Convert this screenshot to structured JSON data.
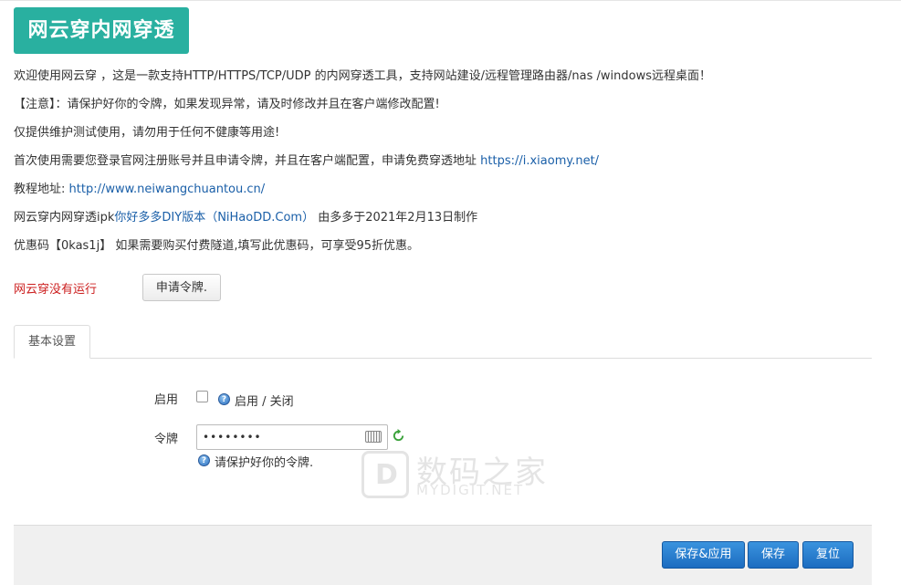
{
  "header": {
    "title": "网云穿内网穿透"
  },
  "intro": {
    "line1": "欢迎使用网云穿 ，这是一款支持HTTP/HTTPS/TCP/UDP 的内网穿透工具，支持网站建设/远程管理路由器/nas /windows远程桌面！",
    "line2": "【注意】：请保护好你的令牌，如果发现异常，请及时修改并且在客户端修改配置!",
    "line3": "仅提供维护测试使用，请勿用于任何不健康等用途!",
    "line4_prefix": "首次使用需要您登录官网注册账号并且申请令牌，并且在客户端配置，申请免费穿透地址 ",
    "line4_link": "https://i.xiaomy.net/",
    "line5_prefix": "教程地址: ",
    "line5_link": "http://www.neiwangchuantou.cn/",
    "line6_prefix": "网云穿内网穿透ipk",
    "line6_link": "你好多多DIY版本（NiHaoDD.Com）",
    "line6_suffix": "由多多于2021年2月13日制作",
    "line7": "优惠码【0kas1j】 如果需要购买付费隧道,填写此优惠码，可享受95折优惠。"
  },
  "status": {
    "text": "网云穿没有运行",
    "apply_button": "申请令牌."
  },
  "tabs": [
    {
      "label": "基本设置"
    }
  ],
  "form": {
    "enable": {
      "label": "启用",
      "checked": false,
      "help": "启用 / 关闭"
    },
    "token": {
      "label": "令牌",
      "value": "••••••••",
      "help": "请保护好你的令牌."
    }
  },
  "footer": {
    "save_apply": "保存&应用",
    "save": "保存",
    "reset": "复位"
  },
  "watermark": {
    "text": "数码之家",
    "sub": "MYDIGIT.NET",
    "glyph": "D"
  },
  "colors": {
    "accent": "#29b0a0",
    "link": "#1a5fa8",
    "status_error": "#cc1f1f",
    "primary_button": "#1c6cc0"
  }
}
